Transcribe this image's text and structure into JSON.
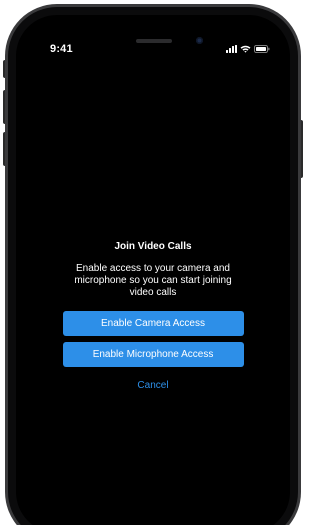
{
  "status_bar": {
    "time": "9:41",
    "icons": [
      "cellular-signal-icon",
      "wifi-icon",
      "battery-icon"
    ]
  },
  "dialog": {
    "title": "Join Video Calls",
    "body": "Enable access to your camera and microphone so you can start joining video calls",
    "camera_button_label": "Enable Camera Access",
    "microphone_button_label": "Enable Microphone Access",
    "cancel_label": "Cancel"
  },
  "colors": {
    "background": "#000000",
    "accent": "#2d8fe8",
    "text": "#ffffff",
    "device_frame": "#3a3a3c"
  }
}
